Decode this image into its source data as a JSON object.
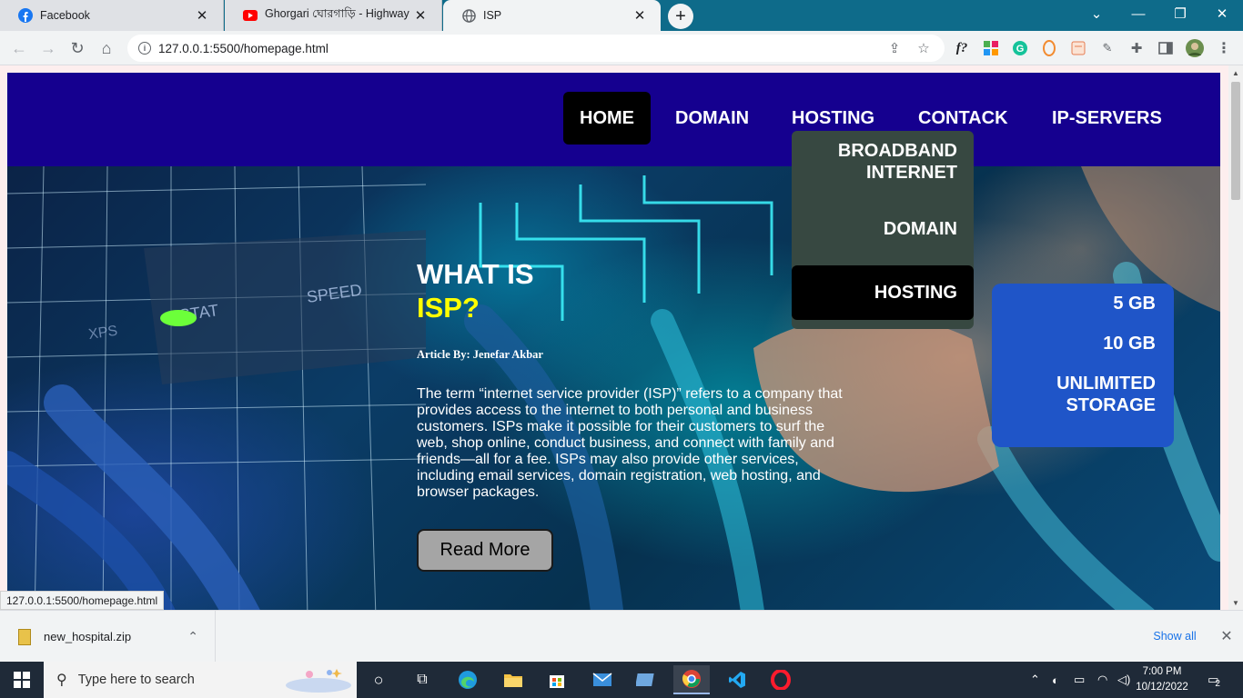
{
  "browser": {
    "tabs": [
      {
        "title": "Facebook",
        "icon": "facebook-icon",
        "color": "#1877f2"
      },
      {
        "title": "Ghorgari ঘোরগাড়ি - Highway (lyr",
        "icon": "youtube-icon",
        "color": "#ff0000"
      },
      {
        "title": "ISP",
        "icon": "globe-icon",
        "color": "#5f6368"
      }
    ],
    "new_tab_symbol": "+",
    "close_symbol": "✕",
    "url": "127.0.0.1:5500/homepage.html",
    "info_symbol": "i",
    "status_url": "127.0.0.1:5500/homepage.html"
  },
  "site": {
    "brand_color": "#15008f",
    "nav": [
      {
        "label": "HOME",
        "active": true
      },
      {
        "label": "DOMAIN",
        "active": false
      },
      {
        "label": "HOSTING",
        "active": false
      },
      {
        "label": "CONTACK",
        "active": false
      },
      {
        "label": "IP-SERVERS",
        "active": false
      }
    ],
    "dropdown": [
      {
        "label_line1": "BROADBAND",
        "label_line2": "INTERNET"
      },
      {
        "label_line1": "DOMAIN"
      },
      {
        "label_line1": "HOSTING",
        "active": true
      }
    ],
    "submenu": [
      {
        "line1": "5 GB"
      },
      {
        "line1": "10 GB"
      },
      {
        "line1": "UNLIMITED",
        "line2": "STORAGE"
      }
    ],
    "article": {
      "heading_line1": "WHAT IS",
      "heading_line2": "ISP?",
      "heading_accent": "#ffff00",
      "byline": "Article By: Jenefar Akbar",
      "body": "The term “internet service provider (ISP)” refers to a company that provides access to the internet to both personal and business customers. ISPs make it possible for their customers to surf the web, shop online, conduct business, and connect with family and friends—all for a fee. ISPs may also provide other services, including email services, domain registration, web hosting, and browser packages.",
      "button": "Read More"
    }
  },
  "download_bar": {
    "file": "new_hospital.zip",
    "show_all": "Show all"
  },
  "taskbar": {
    "search_placeholder": "Type here to search",
    "time": "7:00 PM",
    "date": "10/12/2022",
    "notifications": "2"
  }
}
